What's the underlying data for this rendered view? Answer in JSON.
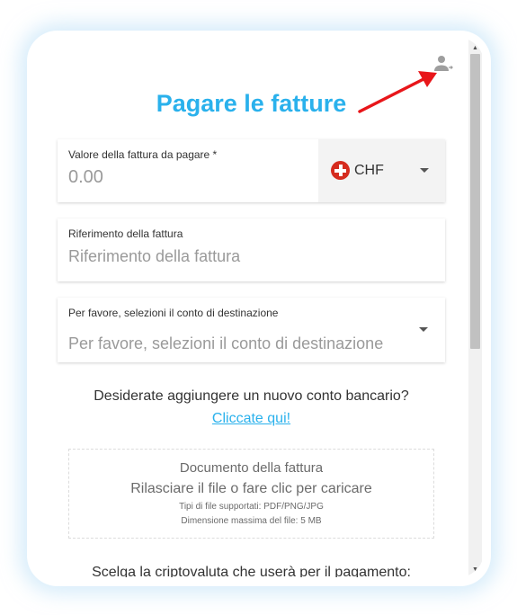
{
  "title": "Pagare le fatture",
  "invoice_value": {
    "label": "Valore della fattura da pagare *",
    "placeholder": "0.00"
  },
  "currency": {
    "code": "CHF",
    "flag_icon": "swiss-flag-icon"
  },
  "invoice_reference": {
    "label": "Riferimento della fattura",
    "placeholder": "Riferimento della fattura"
  },
  "destination_account": {
    "label": "Per favore, selezioni il conto di destinazione",
    "placeholder": "Per favore, selezioni il conto di destinazione"
  },
  "new_account": {
    "question": "Desiderate aggiungere un nuovo conto bancario?",
    "link": "Cliccate qui!"
  },
  "upload": {
    "title": "Documento della fattura",
    "instruction": "Rilasciare il file o fare clic per caricare",
    "file_types": "Tipi di file supportati: PDF/PNG/JPG",
    "max_size": "Dimensione massima del file: 5 MB"
  },
  "crypto_prompt": "Scelga la criptovaluta che userà per il pagamento:",
  "icons": {
    "user": "user-switch-icon",
    "annotation": "red-arrow-icon"
  },
  "colors": {
    "accent": "#2ab1ec",
    "annotation": "#e8161a",
    "swiss_red": "#d52b1e"
  }
}
